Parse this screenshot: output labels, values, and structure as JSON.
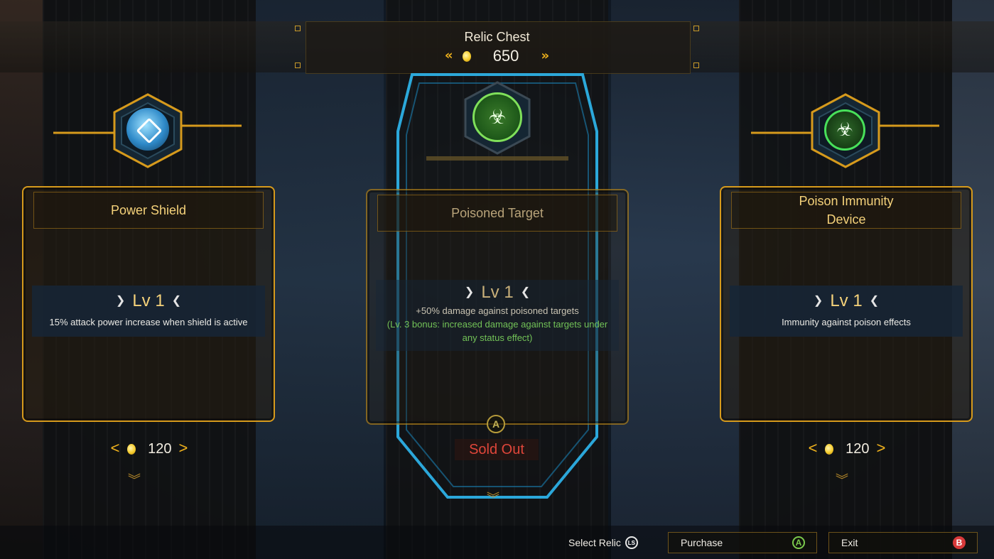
{
  "header": {
    "title": "Relic Chest",
    "currency_amount": "650"
  },
  "relics": [
    {
      "name": "Power Shield",
      "level": "Lv 1",
      "description": "15% attack power increase when shield is active",
      "price": "120",
      "icon": "power-shield-icon"
    },
    {
      "name": "Poisoned Target",
      "level": "Lv 1",
      "description": "+50% damage against poisoned targets",
      "bonus_line1": "(Lv. 3 bonus: increased damage against targets under",
      "bonus_line2": "any status effect)",
      "status": "Sold Out",
      "button_glyph": "A",
      "icon": "biohazard-target-icon"
    },
    {
      "name_line1": "Poison Immunity",
      "name_line2": "Device",
      "level": "Lv 1",
      "description": "Immunity against poison effects",
      "price": "120",
      "icon": "biohazard-icon"
    }
  ],
  "footer": {
    "select_label": "Select Relic",
    "select_glyph": "LS",
    "purchase_label": "Purchase",
    "purchase_glyph": "A",
    "exit_label": "Exit",
    "exit_glyph": "B"
  },
  "colors": {
    "accent_gold": "#d69a1c",
    "level_text": "#f5d27a",
    "bonus_green": "#72c257",
    "sold_out_red": "#e0463a",
    "neon_blue": "#2fb8f0"
  }
}
